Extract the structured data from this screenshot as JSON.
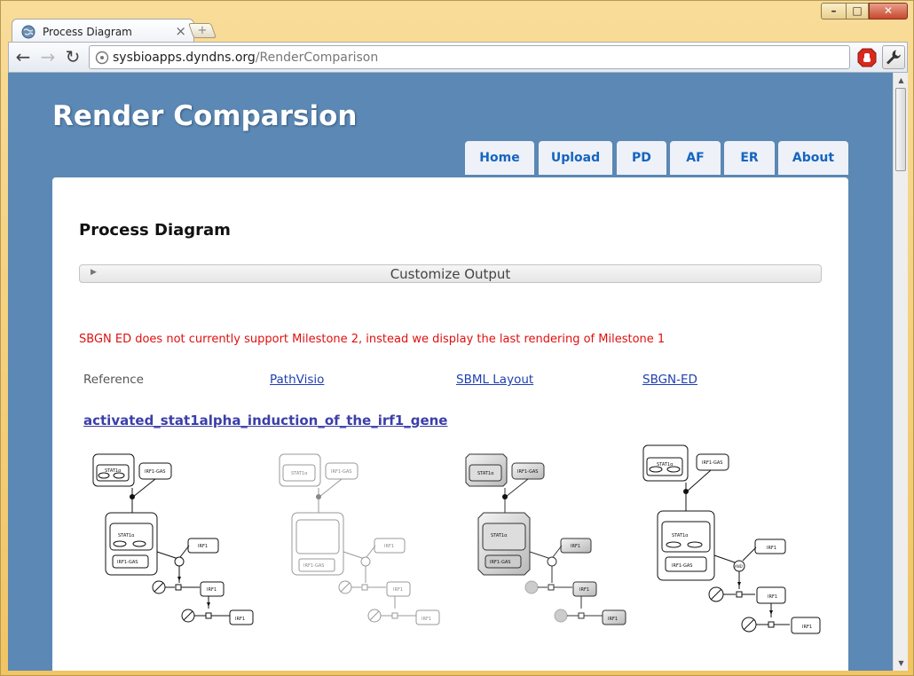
{
  "browser": {
    "tab_title": "Process Diagram",
    "tab_close": "×",
    "new_tab": "+",
    "url_host": "sysbioapps.dyndns.org",
    "url_path": "/RenderComparison",
    "controls": {
      "minimize": "–",
      "maximize": "□",
      "close": "✕"
    },
    "nav": {
      "back": "←",
      "forward": "→",
      "reload": "↻"
    }
  },
  "site": {
    "title": "Render Comparsion",
    "nav": [
      {
        "label": "Home"
      },
      {
        "label": "Upload"
      },
      {
        "label": "PD"
      },
      {
        "label": "AF"
      },
      {
        "label": "ER"
      },
      {
        "label": "About"
      }
    ]
  },
  "content": {
    "heading": "Process Diagram",
    "customize_label": "Customize Output",
    "warning": "SBGN ED does not currently support Milestone 2, instead we display the last rendering of Milestone 1",
    "columns": [
      "Reference",
      "PathVisio",
      "SBML Layout",
      "SBGN-ED"
    ],
    "map_title": "activated_stat1alpha_induction_of_the_irf1_gene"
  },
  "diagram_labels": {
    "complex": "STAT1α",
    "gene": "IRF1-GAS",
    "protein": "IRF1",
    "and_gate": "AND"
  },
  "colors": {
    "page_bg": "#5b88b4",
    "link": "#1f3fb0",
    "warning": "#e01010",
    "nav_text": "#1565c0"
  }
}
